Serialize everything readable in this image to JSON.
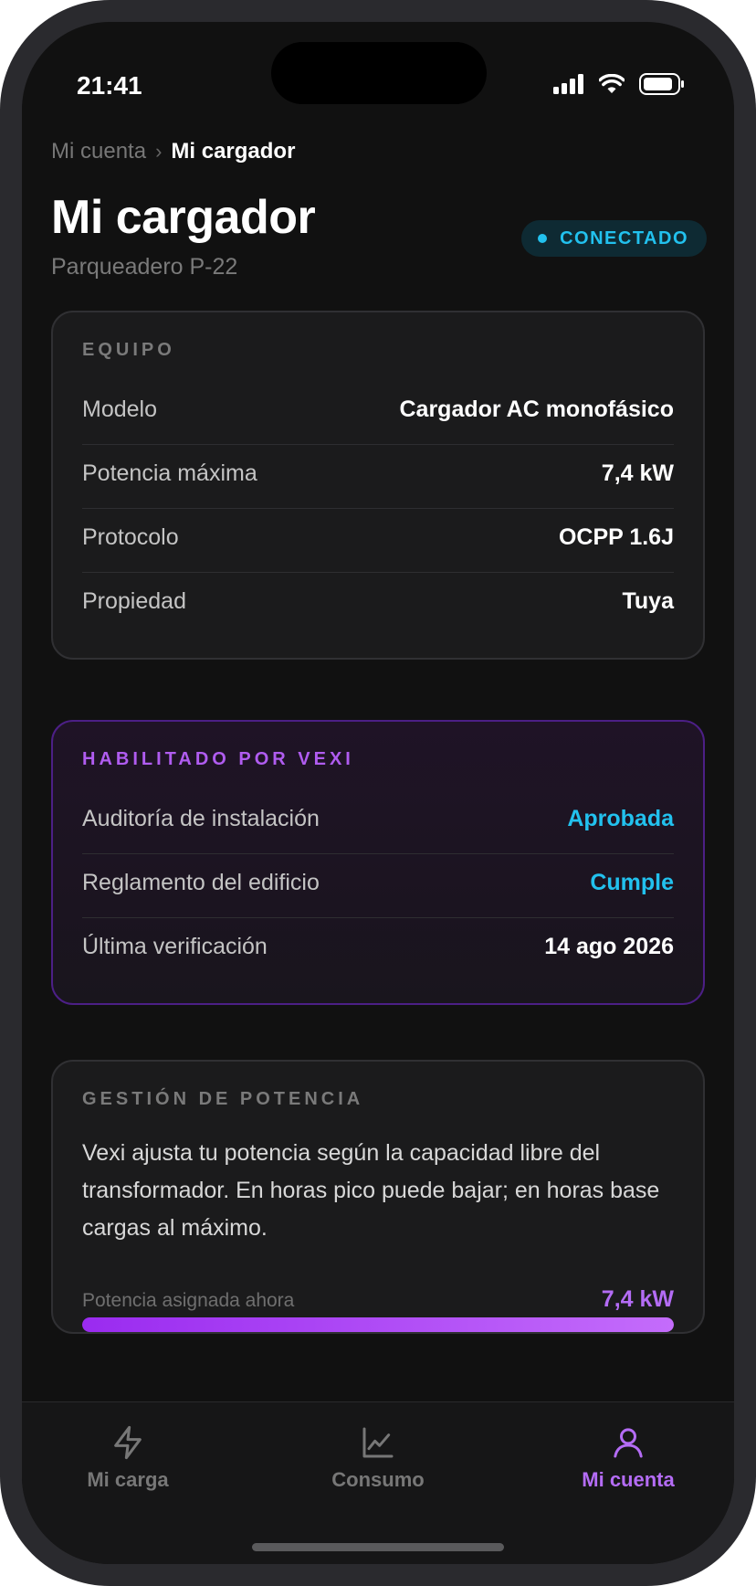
{
  "status_bar": {
    "time": "21:41"
  },
  "breadcrumb": {
    "parent": "Mi cuenta",
    "separator": "›",
    "current": "Mi cargador"
  },
  "header": {
    "title": "Mi cargador",
    "subtitle": "Parqueadero P-22",
    "status_badge": "CONECTADO"
  },
  "equipo": {
    "label": "EQUIPO",
    "rows": [
      {
        "key": "Modelo",
        "value": "Cargador AC monofásico"
      },
      {
        "key": "Potencia máxima",
        "value": "7,4 kW"
      },
      {
        "key": "Protocolo",
        "value": "OCPP 1.6J"
      },
      {
        "key": "Propiedad",
        "value": "Tuya"
      }
    ]
  },
  "vexi": {
    "label": "HABILITADO POR VEXI",
    "rows": [
      {
        "key": "Auditoría de instalación",
        "value": "Aprobada"
      },
      {
        "key": "Reglamento del edificio",
        "value": "Cumple"
      },
      {
        "key": "Última verificación",
        "value": "14 ago 2026"
      }
    ]
  },
  "gestion": {
    "label": "GESTIÓN DE POTENCIA",
    "description": "Vexi ajusta tu potencia según la capacidad libre del transformador. En horas pico puede bajar; en horas base cargas al máximo.",
    "power_label": "Potencia asignada ahora",
    "power_value": "7,4 kW",
    "power_fraction": 1.0
  },
  "tabs": [
    {
      "label": "Mi carga",
      "icon": "bolt-icon"
    },
    {
      "label": "Consumo",
      "icon": "chart-icon"
    },
    {
      "label": "Mi cuenta",
      "icon": "user-icon"
    }
  ],
  "colors": {
    "accent_purple": "#b46cf5",
    "accent_cyan": "#22c1ee",
    "background": "#111111"
  }
}
